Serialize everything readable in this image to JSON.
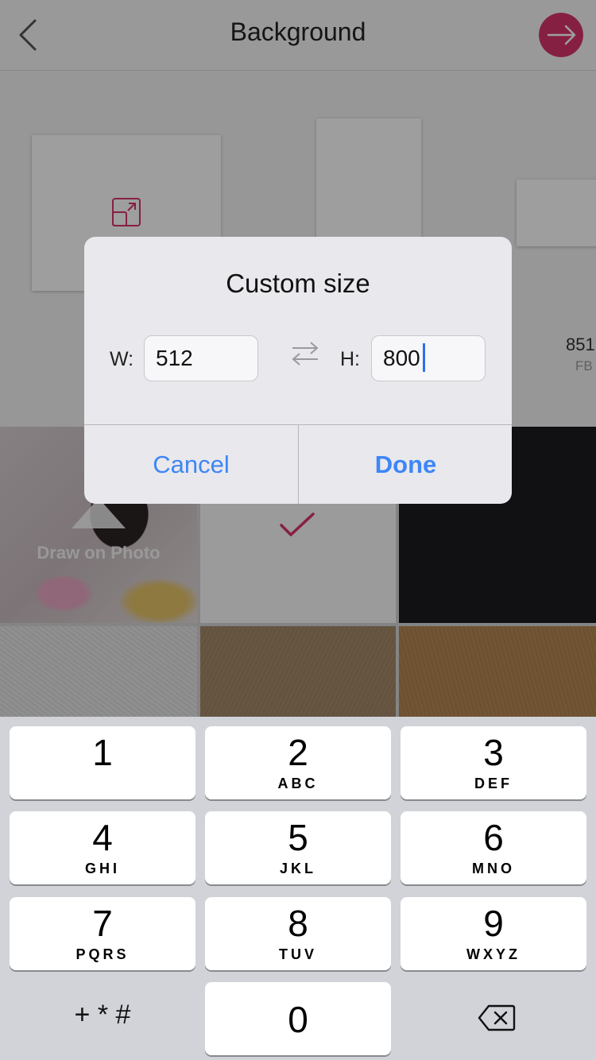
{
  "nav": {
    "title": "Background",
    "back_icon": "chevron-left-icon",
    "next_icon": "arrow-right-icon",
    "accent": "#d8356d"
  },
  "presets": {
    "partial_size": "851",
    "partial_sub": "FB"
  },
  "tiles": {
    "draw_label": "Draw on Photo"
  },
  "dialog": {
    "title": "Custom size",
    "w_label": "W:",
    "h_label": "H:",
    "width_value": "512",
    "height_value": "800",
    "swap_icon": "swap-arrows-icon",
    "cancel_label": "Cancel",
    "done_label": "Done",
    "button_color": "#3d86f6"
  },
  "keypad": {
    "keys": [
      {
        "num": "1",
        "letters": ""
      },
      {
        "num": "2",
        "letters": "ABC"
      },
      {
        "num": "3",
        "letters": "DEF"
      },
      {
        "num": "4",
        "letters": "GHI"
      },
      {
        "num": "5",
        "letters": "JKL"
      },
      {
        "num": "6",
        "letters": "MNO"
      },
      {
        "num": "7",
        "letters": "PQRS"
      },
      {
        "num": "8",
        "letters": "TUV"
      },
      {
        "num": "9",
        "letters": "WXYZ"
      },
      {
        "num": "0",
        "letters": ""
      }
    ],
    "symbols_label": "+ * #",
    "delete_icon": "backspace-icon"
  }
}
